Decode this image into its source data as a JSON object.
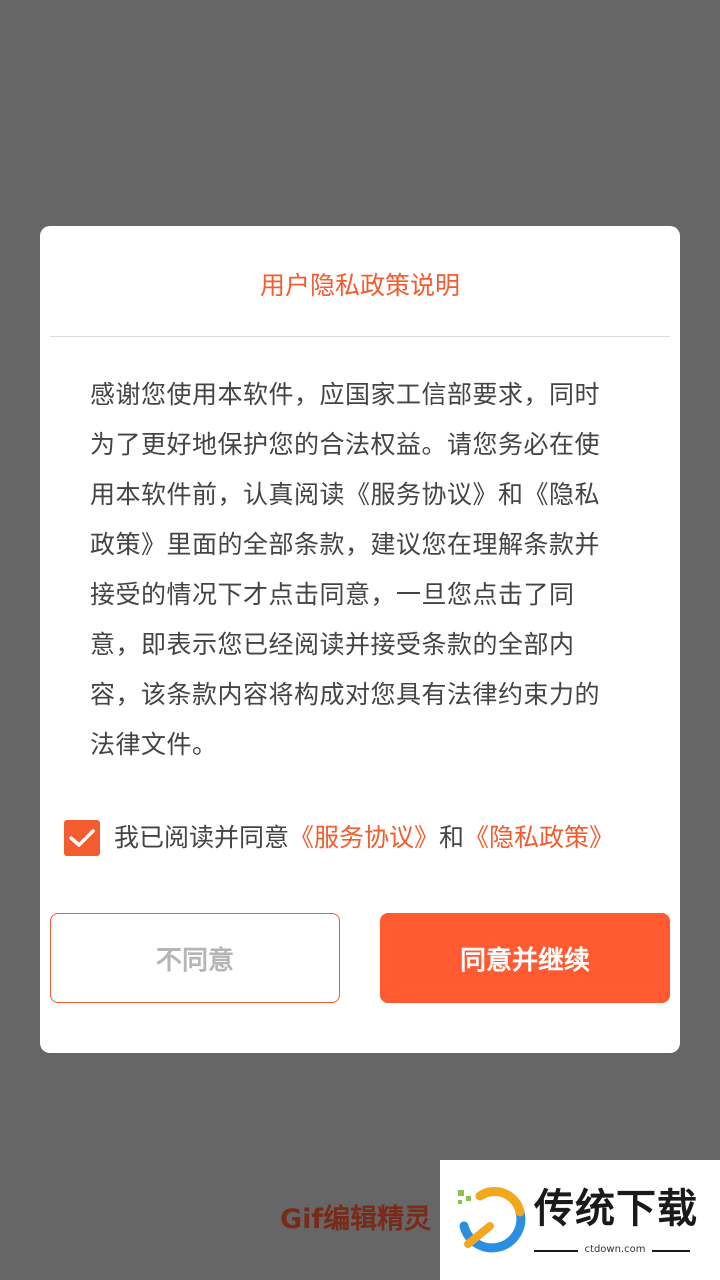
{
  "dialog": {
    "title": "用户隐私政策说明",
    "body": "感谢您使用本软件，应国家工信部要求，同时为了更好地保护您的合法权益。请您务必在使用本软件前，认真阅读《服务协议》和《隐私政策》里面的全部条款，建议您在理解条款并接受的情况下才点击同意，一旦您点击了同意，即表示您已经阅读并接受条款的全部内容，该条款内容将构成对您具有法律约束力的法律文件。",
    "agree_prefix": "我已阅读并同意",
    "service_link": "《服务协议》",
    "and_text": "和",
    "privacy_link": "《隐私政策》",
    "checkbox_checked": true,
    "disagree_label": "不同意",
    "agree_label": "同意并继续"
  },
  "background": {
    "app_name": "Gif编辑精灵"
  },
  "watermark": {
    "brand": "传统下载",
    "url": "ctdown.com"
  },
  "colors": {
    "accent": "#f25c2e",
    "overlay": "#666666",
    "button_primary": "#ff5a30"
  }
}
